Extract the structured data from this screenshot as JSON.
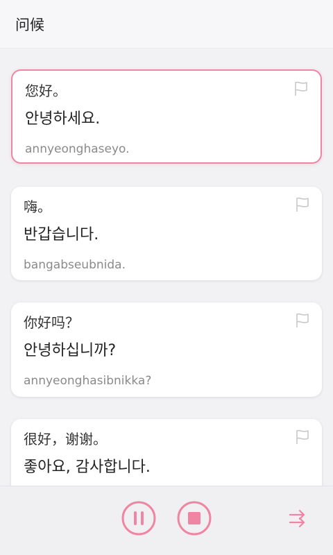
{
  "header": {
    "title": "问候"
  },
  "colors": {
    "accent": "#ef84a3",
    "flag": "#c8c8cc"
  },
  "cards": [
    {
      "zh": "您好。",
      "ko": "안녕하세요.",
      "rom": "annyeonghaseyo.",
      "active": true
    },
    {
      "zh": "嗨。",
      "ko": "반갑습니다.",
      "rom": "bangabseubnida.",
      "active": false
    },
    {
      "zh": "你好吗？",
      "ko": "안녕하십니까?",
      "rom": "annyeonghasibnikka?",
      "active": false
    },
    {
      "zh": "很好，谢谢。",
      "ko": "좋아요, 감사합니다.",
      "rom": "",
      "active": false
    }
  ],
  "controls": {
    "pause_icon": "pause-circle-icon",
    "stop_icon": "stop-circle-icon",
    "order_icon": "sequential-play-icon"
  }
}
